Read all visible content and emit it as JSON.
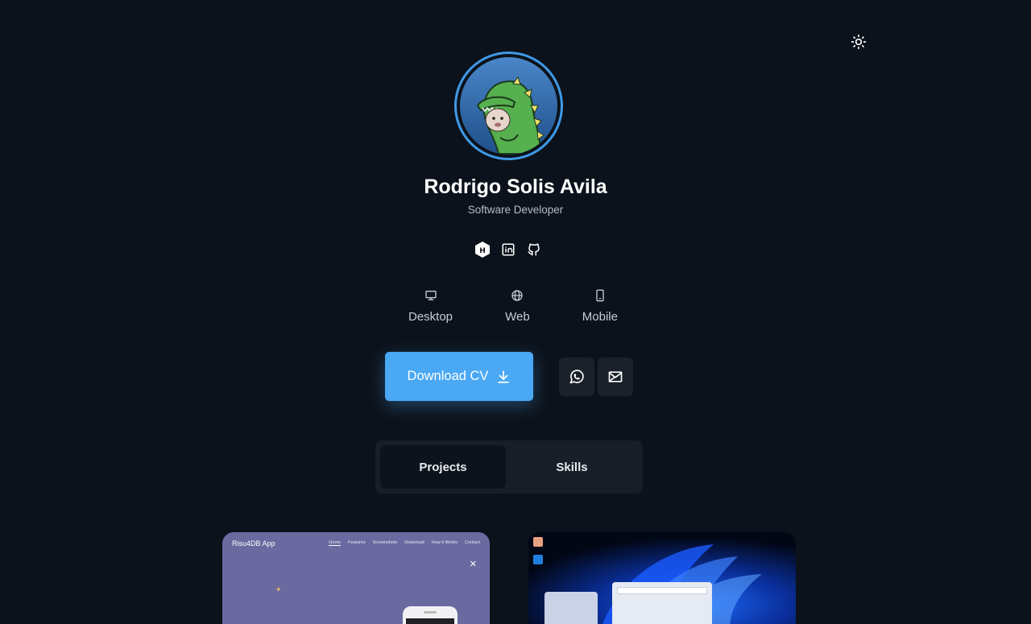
{
  "profile": {
    "name": "Rodrigo Solis Avila",
    "role": "Software Developer"
  },
  "socials": [
    {
      "id": "hashnode",
      "icon": "hashnode-icon"
    },
    {
      "id": "linkedin",
      "icon": "linkedin-icon"
    },
    {
      "id": "github",
      "icon": "github-icon"
    }
  ],
  "platforms": [
    {
      "label": "Desktop",
      "icon": "monitor-icon"
    },
    {
      "label": "Web",
      "icon": "globe-icon"
    },
    {
      "label": "Mobile",
      "icon": "smartphone-icon"
    }
  ],
  "actions": {
    "download_cv_label": "Download CV"
  },
  "tabs": [
    {
      "label": "Projects",
      "active": true
    },
    {
      "label": "Skills",
      "active": false
    }
  ],
  "projects": [
    {
      "brand": "Risu4DB App",
      "nav": [
        "Home",
        "Features",
        "Screenshots",
        "Download",
        "How it Works",
        "Contact"
      ],
      "close_glyph": "✕"
    },
    {
      "desktop_icons": [
        "tomatodo-icon",
        "vscode-icon"
      ]
    }
  ],
  "colors": {
    "background": "#0c121b",
    "accent": "#4aa8f4",
    "avatar_ring": "#3f9ae8",
    "tab_container": "#171e28"
  }
}
